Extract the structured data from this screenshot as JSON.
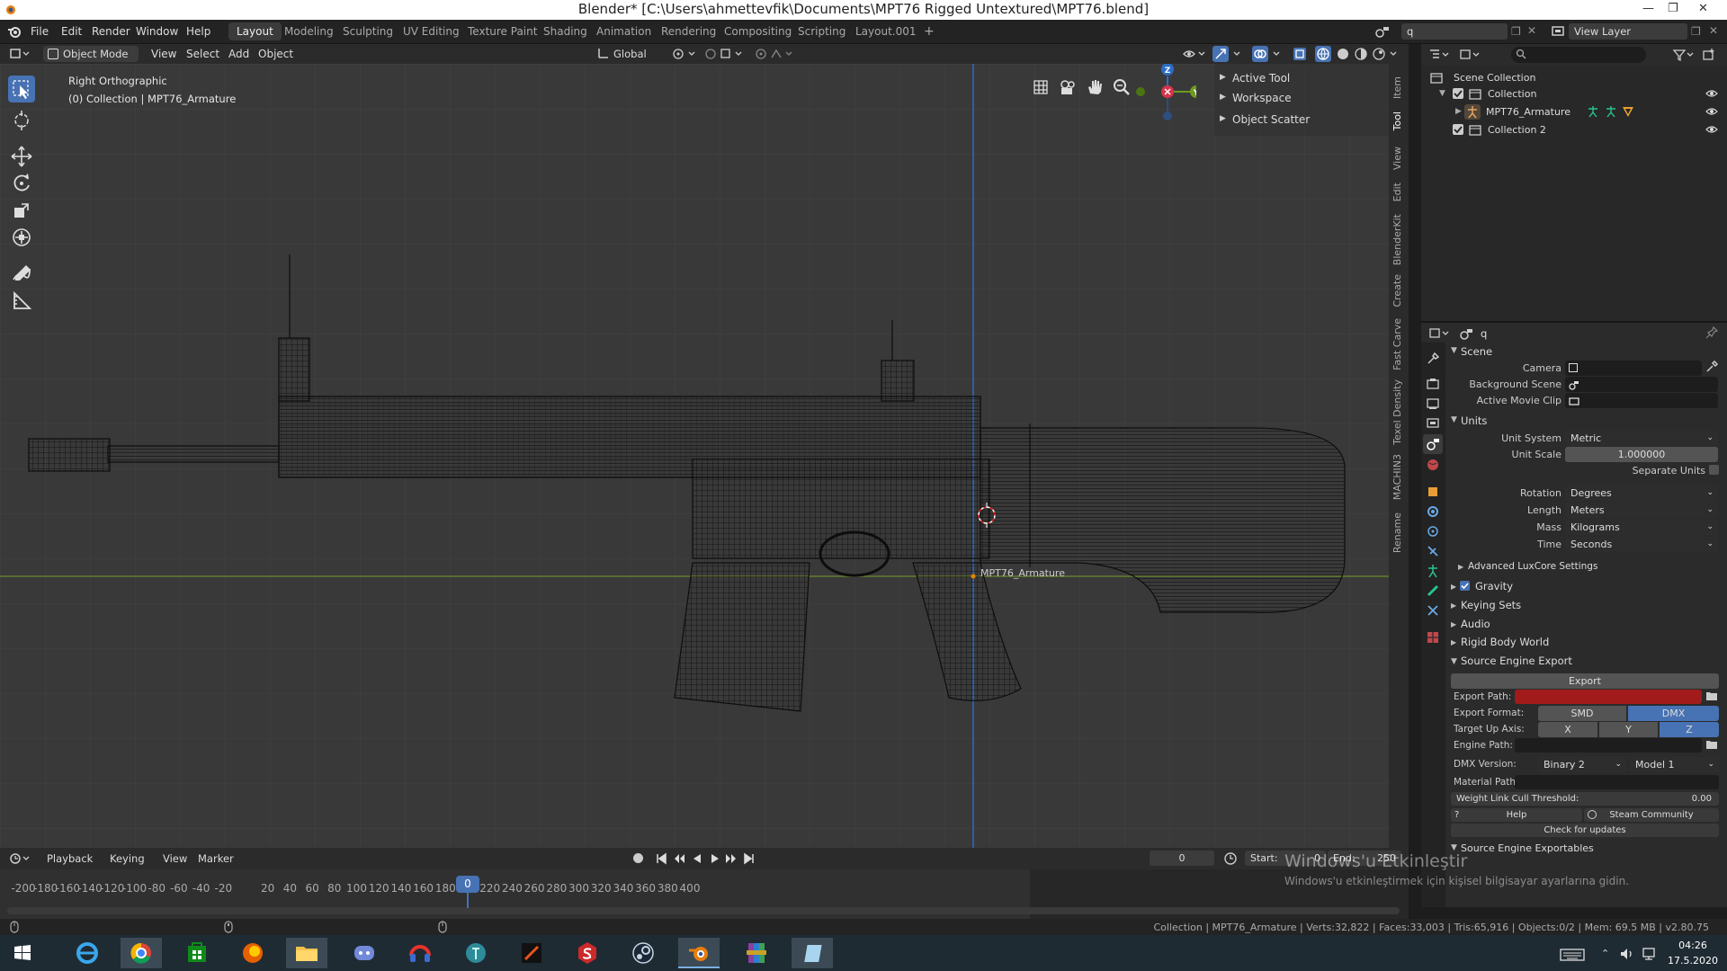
{
  "window": {
    "title": "Blender* [C:\\Users\\ahmettevfik\\Documents\\MPT76 Rigged Untextured\\MPT76.blend]"
  },
  "menubar": [
    "File",
    "Edit",
    "Render",
    "Window",
    "Help"
  ],
  "workspaces": [
    "Layout",
    "Modeling",
    "Sculpting",
    "UV Editing",
    "Texture Paint",
    "Shading",
    "Animation",
    "Rendering",
    "Compositing",
    "Scripting",
    "Layout.001"
  ],
  "topbar_right": {
    "scene_search": "q",
    "view_layer": "View Layer"
  },
  "viewport_header": {
    "mode": "Object Mode",
    "menus": [
      "View",
      "Select",
      "Add",
      "Object"
    ],
    "orientation": "Global"
  },
  "viewport": {
    "view_name": "Right Orthographic",
    "collection_info": "(0) Collection | MPT76_Armature",
    "object_label": "MPT76_Armature",
    "gizmo": {
      "z": "Z",
      "y": "Y"
    }
  },
  "npanel": {
    "items": [
      "Active Tool",
      "Workspace",
      "Object Scatter"
    ],
    "tabs": [
      "Item",
      "Tool",
      "View",
      "Edit",
      "BlenderKit",
      "Create",
      "Fast Carve",
      "Texel Density",
      "MACHIN3",
      "Rename"
    ]
  },
  "outliner": {
    "search": "",
    "root": "Scene Collection",
    "items": [
      {
        "label": "Collection"
      },
      {
        "label": "MPT76_Armature"
      },
      {
        "label": "Collection 2"
      }
    ]
  },
  "properties": {
    "search": "q",
    "scene_header": "Scene",
    "camera_label": "Camera",
    "background_scene_label": "Background Scene",
    "active_movie_clip_label": "Active Movie Clip",
    "units_header": "Units",
    "unit_system_label": "Unit System",
    "unit_system": "Metric",
    "unit_scale_label": "Unit Scale",
    "unit_scale": "1.000000",
    "separate_units": "Separate Units",
    "rotation_label": "Rotation",
    "rotation": "Degrees",
    "length_label": "Length",
    "length": "Meters",
    "mass_label": "Mass",
    "mass": "Kilograms",
    "time_label": "Time",
    "time": "Seconds",
    "sections": [
      "Advanced LuxCore Settings",
      "Gravity",
      "Keying Sets",
      "Audio",
      "Rigid Body World",
      "Source Engine Export"
    ],
    "export_button": "Export",
    "export_path_label": "Export Path:",
    "export_format_label": "Export Format:",
    "smd": "SMD",
    "dmx": "DMX",
    "target_up_axis_label": "Target Up Axis:",
    "axis_x": "X",
    "axis_y": "Y",
    "axis_z": "Z",
    "engine_path_label": "Engine Path:",
    "dmx_version_label": "DMX Version:",
    "dmx_binary": "Binary 2",
    "dmx_model": "Model 1",
    "material_path_label": "Material Path:",
    "weight_link_label": "Weight Link Cull Threshold:",
    "weight_link_value": "0.00",
    "help_button": "Help",
    "steam_button": "Steam Community",
    "check_updates": "Check for updates",
    "exportables": "Source Engine Exportables",
    "accent_red": "#a11b1b",
    "accent_blue": "#4772b3"
  },
  "timeline": {
    "menus": [
      "Playback",
      "Keying",
      "View",
      "Marker"
    ],
    "current_frame": "0",
    "start_label": "Start:",
    "start": "0",
    "end_label": "End:",
    "end": "250",
    "ticks": [
      "-200",
      "-180",
      "-160",
      "-140",
      "-120",
      "-100",
      "-80",
      "-60",
      "-40",
      "-20",
      "0",
      "20",
      "40",
      "60",
      "80",
      "100",
      "120",
      "140",
      "160",
      "180",
      "200",
      "220",
      "240",
      "260",
      "280",
      "300",
      "320",
      "340",
      "360",
      "380",
      "400"
    ]
  },
  "watermark": {
    "line1": "Windows'u Etkinleştir",
    "line2": "Windows'u etkinleştirmek için kişisel bilgisayar ayarlarına gidin."
  },
  "statusbar": {
    "text": "Collection | MPT76_Armature | Verts:32,822 | Faces:33,003 | Tris:65,916 | Objects:0/2 | Mem: 69.5 MB | v2.80.75"
  },
  "taskbar": {
    "time": "04:26",
    "date": "17.5.2020"
  }
}
